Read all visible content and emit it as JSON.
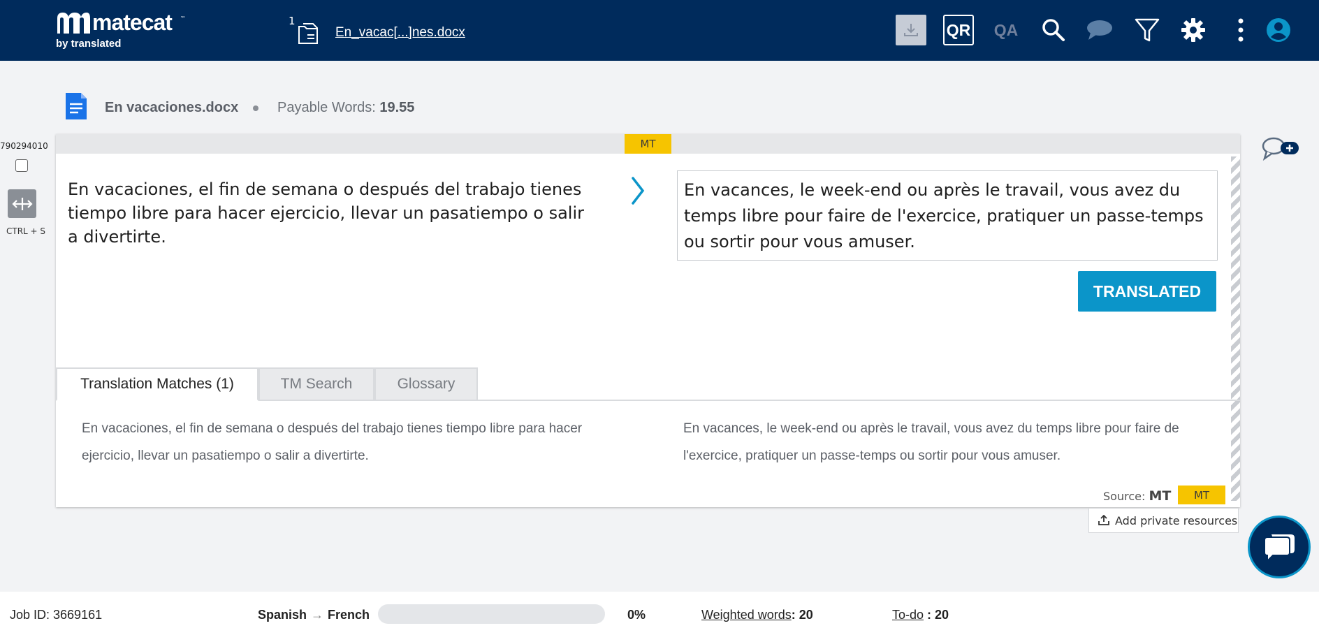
{
  "header": {
    "logo_name": "matecat",
    "logo_tm": "™",
    "logo_sub": "by translated",
    "file_count": "1",
    "file_link": "En_vacac[...]nes.docx",
    "qr_label": "QR",
    "qa_label": "QA"
  },
  "file_info": {
    "doc_name": "En vacaciones.docx",
    "payable_label": "Payable Words:",
    "payable_value": "19.55"
  },
  "segment": {
    "id": "790294010",
    "shortcut": "CTRL + S",
    "badge": "MT",
    "source": "En vacaciones, el fin de semana o después del trabajo tienes tiempo libre para hacer ejercicio, llevar un pasatiempo o salir a divertirte.",
    "target": "En vacances, le week-end ou après le travail, vous avez du temps libre pour faire de l'exercice, pratiquer un passe-temps ou sortir pour vous amuser.",
    "status_button": "TRANSLATED"
  },
  "tabs": [
    {
      "label": "Translation Matches (1)"
    },
    {
      "label": "TM Search"
    },
    {
      "label": "Glossary"
    }
  ],
  "match": {
    "source": "En vacaciones, el fin de semana o después del trabajo tienes tiempo libre para hacer ejercicio, llevar un pasatiempo o salir a divertirte.",
    "target": "En vacances, le week-end ou après le travail, vous avez du temps libre pour faire de l'exercice, pratiquer un passe-temps ou sortir pour vous amuser.",
    "source_label": "Source:",
    "source_value": "MT",
    "badge": "MT"
  },
  "add_private_resources": "Add private resources",
  "footer": {
    "job_id": "Job ID: 3669161",
    "source_lang": "Spanish",
    "arrow": "→",
    "target_lang": "French",
    "progress_percent": 0,
    "progress_label": "0%",
    "weighted_label": "Weighted words",
    "weighted_value": ": 20",
    "todo_label": "To-do",
    "todo_value": " : 20"
  },
  "colors": {
    "header_bg": "#002b5c",
    "accent": "#0b95c9",
    "mt_badge": "#f6c400"
  },
  "icons": [
    "file-upload-icon",
    "document-icon",
    "download-icon",
    "search-icon",
    "comment-icon",
    "filter-icon",
    "gear-icon",
    "more-vertical-icon",
    "user-icon",
    "copy-source-icon",
    "chevron-right-icon",
    "add-comment-icon",
    "upload-icon",
    "chat-icon"
  ]
}
